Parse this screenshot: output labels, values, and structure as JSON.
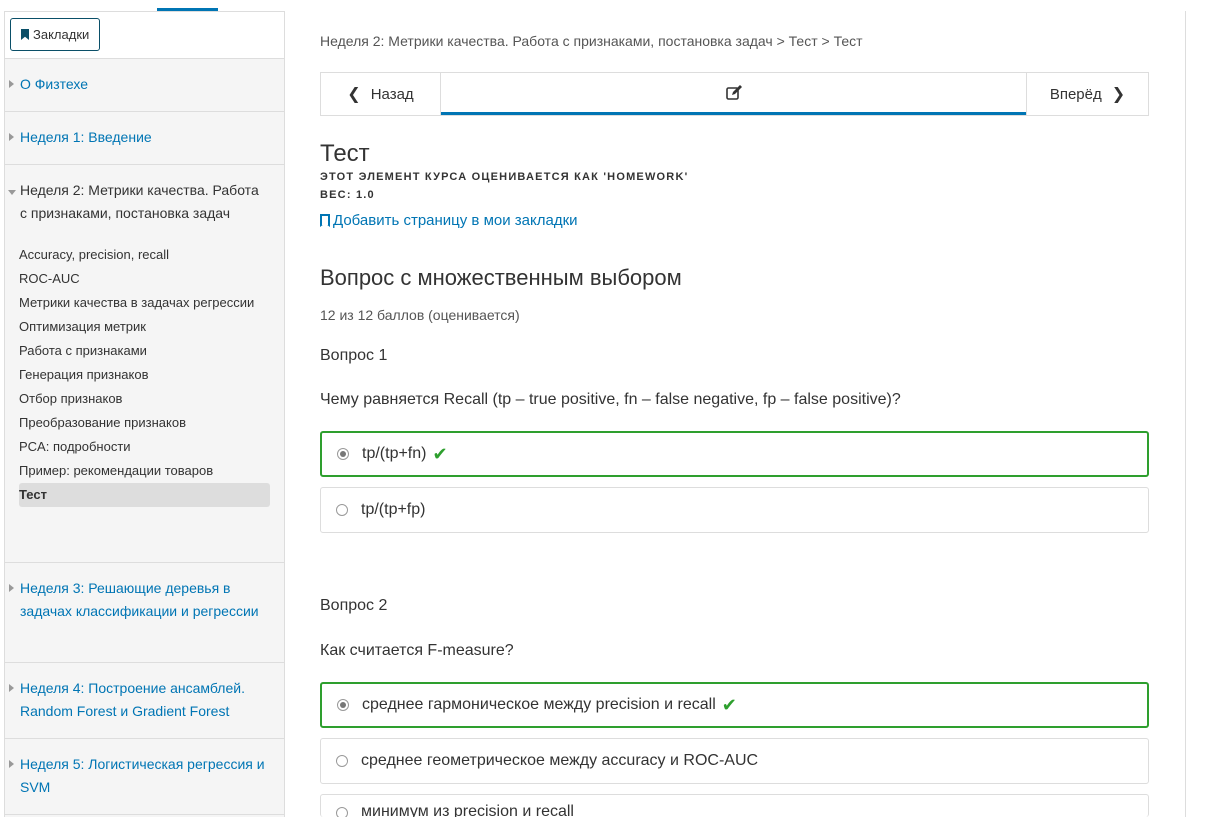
{
  "sidebar": {
    "bookmarks_label": "Закладки",
    "chapters": [
      {
        "title": "О Физтехе"
      },
      {
        "title": "Неделя 1: Введение"
      },
      {
        "title": "Неделя 2: Метрики качества. Работа с признаками, постановка задач"
      },
      {
        "title": "Неделя 3: Решающие деревья в задачах классификации и регрессии"
      },
      {
        "title": "Неделя 4: Построение ансамблей. Random Forest и Gradient Forest"
      },
      {
        "title": "Неделя 5: Логистическая регрессия и SVM"
      }
    ],
    "subitems": [
      "Accuracy, precision, recall",
      "ROC-AUC",
      "Метрики качества в задачах регрессии",
      "Оптимизация метрик",
      "Работа с признаками",
      "Генерация признаков",
      "Отбор признаков",
      "Преобразование признаков",
      "PCA: подробности",
      "Пример: рекомендации товаров",
      "Тест"
    ]
  },
  "breadcrumb": "Неделя 2: Метрики качества. Работа с признаками, постановка задач > Тест > Тест",
  "nav": {
    "prev_label": "Назад",
    "next_label": "Вперёд"
  },
  "unit": {
    "title": "Тест",
    "graded_as": "ЭТОТ ЭЛЕМЕНТ КУРСА ОЦЕНИВАЕТСЯ КАК 'HOMEWORK'",
    "weight": "ВЕС: 1.0",
    "add_bookmark": "Добавить страницу в мои закладки"
  },
  "problem": {
    "title": "Вопрос с множественным выбором",
    "score": "12 из 12 баллов (оценивается)",
    "q1": {
      "label": "Вопрос 1",
      "text": "Чему равняется Recall (tp – true positive, fn – false negative, fp – false positive)?",
      "options": [
        "tp/(tp+fn)",
        "tp/(tp+fp)"
      ]
    },
    "q2": {
      "label": "Вопрос 2",
      "text": "Как считается F-measure?",
      "options": [
        "среднее гармоническое между precision и recall",
        "среднее геометрическое между accuracy и ROC-AUC",
        "минимум из precision и recall"
      ]
    }
  },
  "colors": {
    "accent": "#0075b4",
    "correct": "#2e9f2e"
  }
}
